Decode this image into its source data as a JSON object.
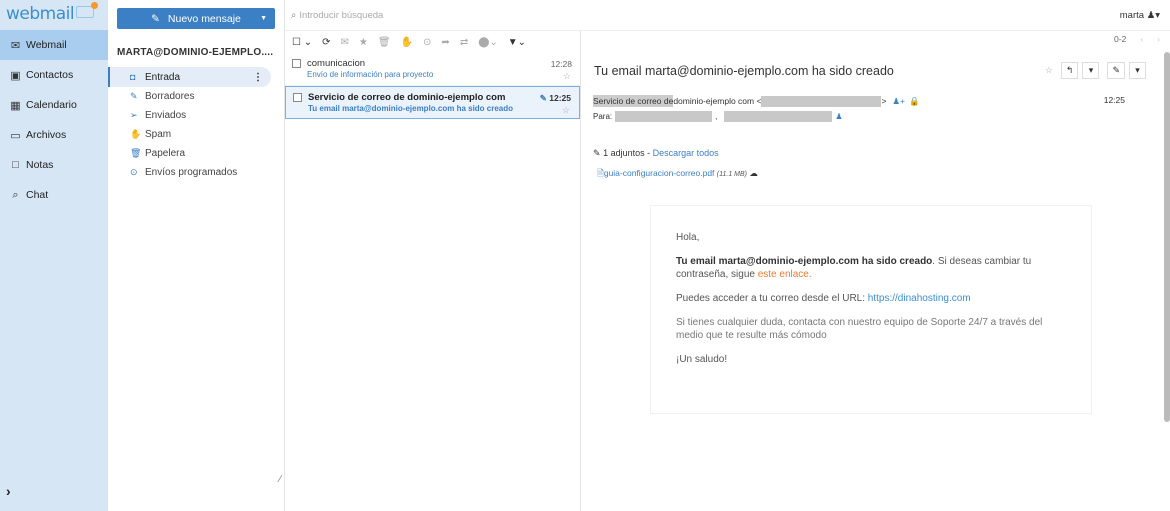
{
  "app": {
    "logo": "webmail"
  },
  "nav": {
    "items": [
      {
        "label": "Webmail",
        "icon": "envelope-icon",
        "glyph": "✉"
      },
      {
        "label": "Contactos",
        "icon": "contacts-icon",
        "glyph": "▣"
      },
      {
        "label": "Calendario",
        "icon": "calendar-icon",
        "glyph": "▦"
      },
      {
        "label": "Archivos",
        "icon": "folder-icon",
        "glyph": "▭"
      },
      {
        "label": "Notas",
        "icon": "note-icon",
        "glyph": "□"
      },
      {
        "label": "Chat",
        "icon": "chat-icon",
        "glyph": "⌕"
      }
    ],
    "expand_glyph": "›"
  },
  "compose": {
    "label": "Nuevo mensaje"
  },
  "account": {
    "name": "MARTA@DOMINIO-EJEMPLO...."
  },
  "folders": [
    {
      "label": "Entrada",
      "glyph": "◘"
    },
    {
      "label": "Borradores",
      "glyph": "✎"
    },
    {
      "label": "Enviados",
      "glyph": "➢"
    },
    {
      "label": "Spam",
      "glyph": "✋"
    },
    {
      "label": "Papelera",
      "glyph": "🗑"
    },
    {
      "label": "Envíos programados",
      "glyph": "⊙"
    }
  ],
  "search": {
    "placeholder": "Introducir búsqueda"
  },
  "user": {
    "name": "marta"
  },
  "pager": {
    "range": "0-2"
  },
  "messages": [
    {
      "from": "comunicacion",
      "subject": "Envío de información para proyecto",
      "time": "12:28"
    },
    {
      "from": "Servicio de correo de dominio-ejemplo com",
      "subject": "Tu email marta@dominio-ejemplo.com ha sido creado",
      "time": "12:25"
    }
  ],
  "reading": {
    "subject": "Tu email marta@dominio-ejemplo.com ha sido creado",
    "from_highlight": "Servicio de correo de",
    "from_rest": " dominio-ejemplo com <",
    "time": "12:25",
    "to_label": "Para:",
    "attachments_label": "1 adjuntos",
    "download_all": "Descargar todos",
    "file_name": "guia-configuracion-correo.pdf",
    "file_size": "(11.1 MB)"
  },
  "body": {
    "greeting": "Hola,",
    "bold_line": "Tu email marta@dominio-ejemplo.com ha sido creado",
    "line1_rest": ". Si deseas cambiar tu contraseña, sigue ",
    "link_text": "este enlace.",
    "url_line": "Puedes acceder a tu correo desde el URL: ",
    "url": "https://dinahosting.com",
    "support": "Si tienes cualquier duda, contacta con nuestro equipo de Soporte 24/7 a través del medio que te resulte más cómodo",
    "farewell": "¡Un saludo!"
  }
}
